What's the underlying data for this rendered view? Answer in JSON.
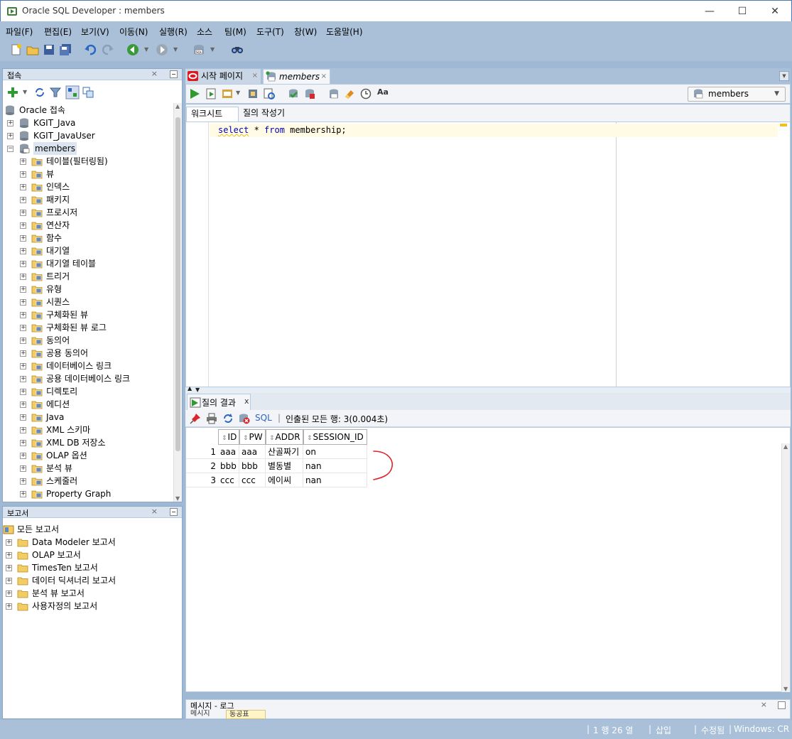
{
  "window": {
    "title": "Oracle SQL Developer : members",
    "min": "—",
    "max": "☐",
    "close": "✕"
  },
  "menu": [
    "파일(F)",
    "편집(E)",
    "보기(V)",
    "이동(N)",
    "실행(R)",
    "소스",
    "팀(M)",
    "도구(T)",
    "창(W)",
    "도움말(H)"
  ],
  "toolbar_icons": [
    "new-icon",
    "open-icon",
    "save-icon",
    "save-all-icon",
    "undo-icon",
    "redo-icon",
    "back-icon",
    "forward-icon",
    "sql-worksheet-icon",
    "find-icon"
  ],
  "connections": {
    "title": "접속",
    "close": "×",
    "root": "Oracle 접속",
    "items": [
      {
        "label": "KGIT_Java",
        "icon": "database-icon",
        "level": 1,
        "expander": "+"
      },
      {
        "label": "KGIT_JavaUser",
        "icon": "database-icon",
        "level": 1,
        "expander": "+"
      },
      {
        "label": "members",
        "icon": "database-connected-icon",
        "level": 1,
        "expander": "−",
        "selected": true
      },
      {
        "label": "테이블(필터링됨)",
        "icon": "table-folder-icon",
        "level": 2,
        "expander": "+"
      },
      {
        "label": "뷰",
        "icon": "view-folder-icon",
        "level": 2,
        "expander": "+"
      },
      {
        "label": "인덱스",
        "icon": "index-folder-icon",
        "level": 2,
        "expander": "+"
      },
      {
        "label": "패키지",
        "icon": "package-folder-icon",
        "level": 2,
        "expander": "+"
      },
      {
        "label": "프로시저",
        "icon": "procedure-folder-icon",
        "level": 2,
        "expander": "+"
      },
      {
        "label": "연산자",
        "icon": "operator-folder-icon",
        "level": 2,
        "expander": "+"
      },
      {
        "label": "함수",
        "icon": "function-folder-icon",
        "level": 2,
        "expander": "+"
      },
      {
        "label": "대기열",
        "icon": "queue-folder-icon",
        "level": 2,
        "expander": "+"
      },
      {
        "label": "대기열 테이블",
        "icon": "queue-table-folder-icon",
        "level": 2,
        "expander": "+"
      },
      {
        "label": "트리거",
        "icon": "trigger-folder-icon",
        "level": 2,
        "expander": "+"
      },
      {
        "label": "유형",
        "icon": "type-folder-icon",
        "level": 2,
        "expander": "+"
      },
      {
        "label": "시퀀스",
        "icon": "sequence-folder-icon",
        "level": 2,
        "expander": "+"
      },
      {
        "label": "구체화된 뷰",
        "icon": "mview-folder-icon",
        "level": 2,
        "expander": "+"
      },
      {
        "label": "구체화된 뷰 로그",
        "icon": "mview-log-folder-icon",
        "level": 2,
        "expander": "+"
      },
      {
        "label": "동의어",
        "icon": "synonym-folder-icon",
        "level": 2,
        "expander": "+"
      },
      {
        "label": "공용 동의어",
        "icon": "public-synonym-folder-icon",
        "level": 2,
        "expander": "+"
      },
      {
        "label": "데이터베이스 링크",
        "icon": "dblink-folder-icon",
        "level": 2,
        "expander": "+"
      },
      {
        "label": "공용 데이터베이스 링크",
        "icon": "public-dblink-folder-icon",
        "level": 2,
        "expander": "+"
      },
      {
        "label": "디렉토리",
        "icon": "directory-folder-icon",
        "level": 2,
        "expander": "+"
      },
      {
        "label": "에디션",
        "icon": "edition-folder-icon",
        "level": 2,
        "expander": "+"
      },
      {
        "label": "Java",
        "icon": "java-folder-icon",
        "level": 2,
        "expander": "+"
      },
      {
        "label": "XML 스키마",
        "icon": "xml-schema-folder-icon",
        "level": 2,
        "expander": "+"
      },
      {
        "label": "XML DB 저장소",
        "icon": "xml-db-folder-icon",
        "level": 2,
        "expander": "+"
      },
      {
        "label": "OLAP 옵션",
        "icon": "olap-folder-icon",
        "level": 2,
        "expander": "+"
      },
      {
        "label": "분석 뷰",
        "icon": "analytic-view-folder-icon",
        "level": 2,
        "expander": "+"
      },
      {
        "label": "스케줄러",
        "icon": "scheduler-folder-icon",
        "level": 2,
        "expander": "+"
      },
      {
        "label": "Property Graph",
        "icon": "property-graph-folder-icon",
        "level": 2,
        "expander": "+"
      }
    ]
  },
  "reports": {
    "title": "보고서",
    "close": "×",
    "root": "모든 보고서",
    "items": [
      {
        "label": "Data Modeler 보고서",
        "expander": "+"
      },
      {
        "label": "OLAP 보고서",
        "expander": "+"
      },
      {
        "label": "TimesTen 보고서",
        "expander": "+"
      },
      {
        "label": "데이터 딕셔너리 보고서",
        "expander": "+"
      },
      {
        "label": "분석 뷰 보고서",
        "expander": "+"
      },
      {
        "label": "사용자정의 보고서",
        "expander": "+"
      }
    ]
  },
  "doc_tabs": [
    {
      "label": "시작 페이지",
      "close": "×",
      "active": false
    },
    {
      "label": "members",
      "close": "×",
      "active": true
    }
  ],
  "connection_select": "members",
  "sub_tabs": [
    "워크시트",
    "질의 작성기"
  ],
  "editor": {
    "code_tokens": [
      {
        "text": "select",
        "kw": true
      },
      {
        "text": " * ",
        "kw": false
      },
      {
        "text": "from",
        "kw": true
      },
      {
        "text": " membership;",
        "kw": false
      }
    ]
  },
  "results": {
    "tab_label": "질의 결과",
    "tab_close": "x",
    "sql_label": "SQL",
    "separator": "|",
    "status": "인출된 모든 행: 3(0.004초)",
    "columns": [
      "ID",
      "PW",
      "ADDR",
      "SESSION_ID"
    ],
    "rows": [
      {
        "num": "1",
        "cells": [
          "aaa",
          "aaa",
          "산골짜기",
          "on"
        ]
      },
      {
        "num": "2",
        "cells": [
          "bbb",
          "bbb",
          "별동별",
          "nan"
        ]
      },
      {
        "num": "3",
        "cells": [
          "ccc",
          "ccc",
          "에이씨",
          "nan"
        ]
      }
    ]
  },
  "log_panel": {
    "title": "메시지 - 로그",
    "close": "×",
    "tab1": "메시지",
    "tab2": "동공표"
  },
  "status_bar": {
    "position": "1 행 26 열",
    "mode": "삽입",
    "modified": "수정됨",
    "eol": "Windows: CR"
  },
  "colors": {
    "annotation": "#e0202a",
    "keyword": "#0000c0",
    "menubar": "#a9c0d8"
  }
}
